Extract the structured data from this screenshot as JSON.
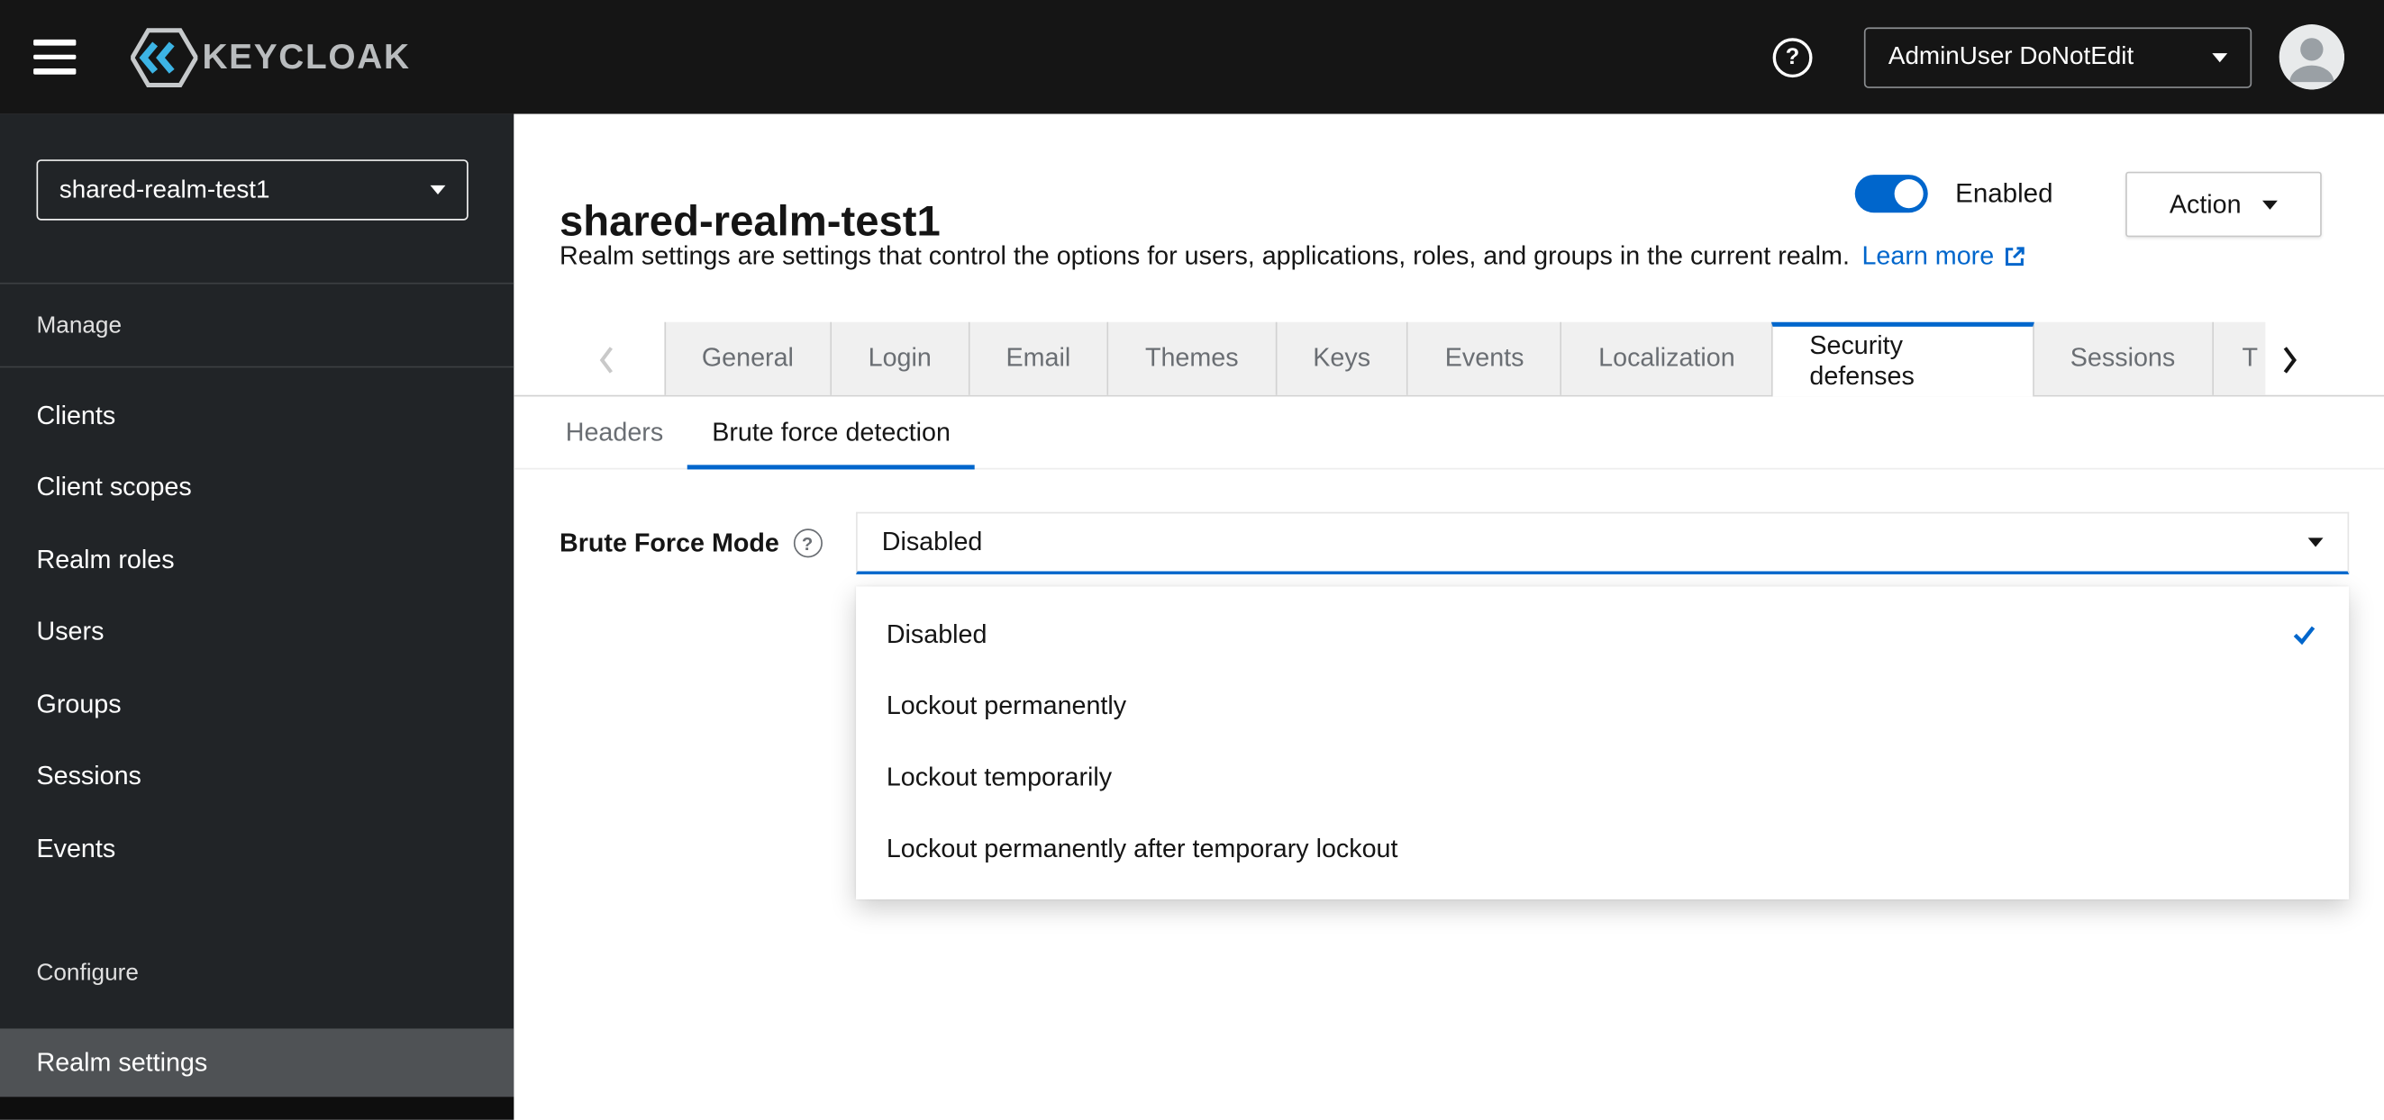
{
  "topbar": {
    "brand": "KEYCLOAK",
    "user_menu_label": "AdminUser DoNotEdit"
  },
  "sidebar": {
    "realm_selector": "shared-realm-test1",
    "groups": [
      {
        "label": "Manage",
        "items": [
          "Clients",
          "Client scopes",
          "Realm roles",
          "Users",
          "Groups",
          "Sessions",
          "Events"
        ]
      },
      {
        "label": "Configure",
        "items": [
          "Realm settings"
        ]
      }
    ],
    "selected_item": "Realm settings"
  },
  "header": {
    "title": "shared-realm-test1",
    "description": "Realm settings are settings that control the options for users, applications, roles, and groups in the current realm.",
    "learn_more_label": "Learn more",
    "enabled_label": "Enabled",
    "action_label": "Action"
  },
  "tabs": {
    "items": [
      "General",
      "Login",
      "Email",
      "Themes",
      "Keys",
      "Events",
      "Localization",
      "Security defenses",
      "Sessions",
      "T"
    ],
    "active": "Security defenses"
  },
  "subtabs": {
    "items": [
      "Headers",
      "Brute force detection"
    ],
    "active": "Brute force detection"
  },
  "form": {
    "brute_force_mode_label": "Brute Force Mode",
    "select_value": "Disabled",
    "dropdown_options": [
      "Disabled",
      "Lockout permanently",
      "Lockout temporarily",
      "Lockout permanently after temporary lockout"
    ],
    "selected_option": "Disabled"
  },
  "icons": {
    "question": "?"
  },
  "colors": {
    "accent": "#0066cc",
    "masthead": "#151515",
    "sidebar": "#212427",
    "selected_nav": "#4f5255"
  }
}
